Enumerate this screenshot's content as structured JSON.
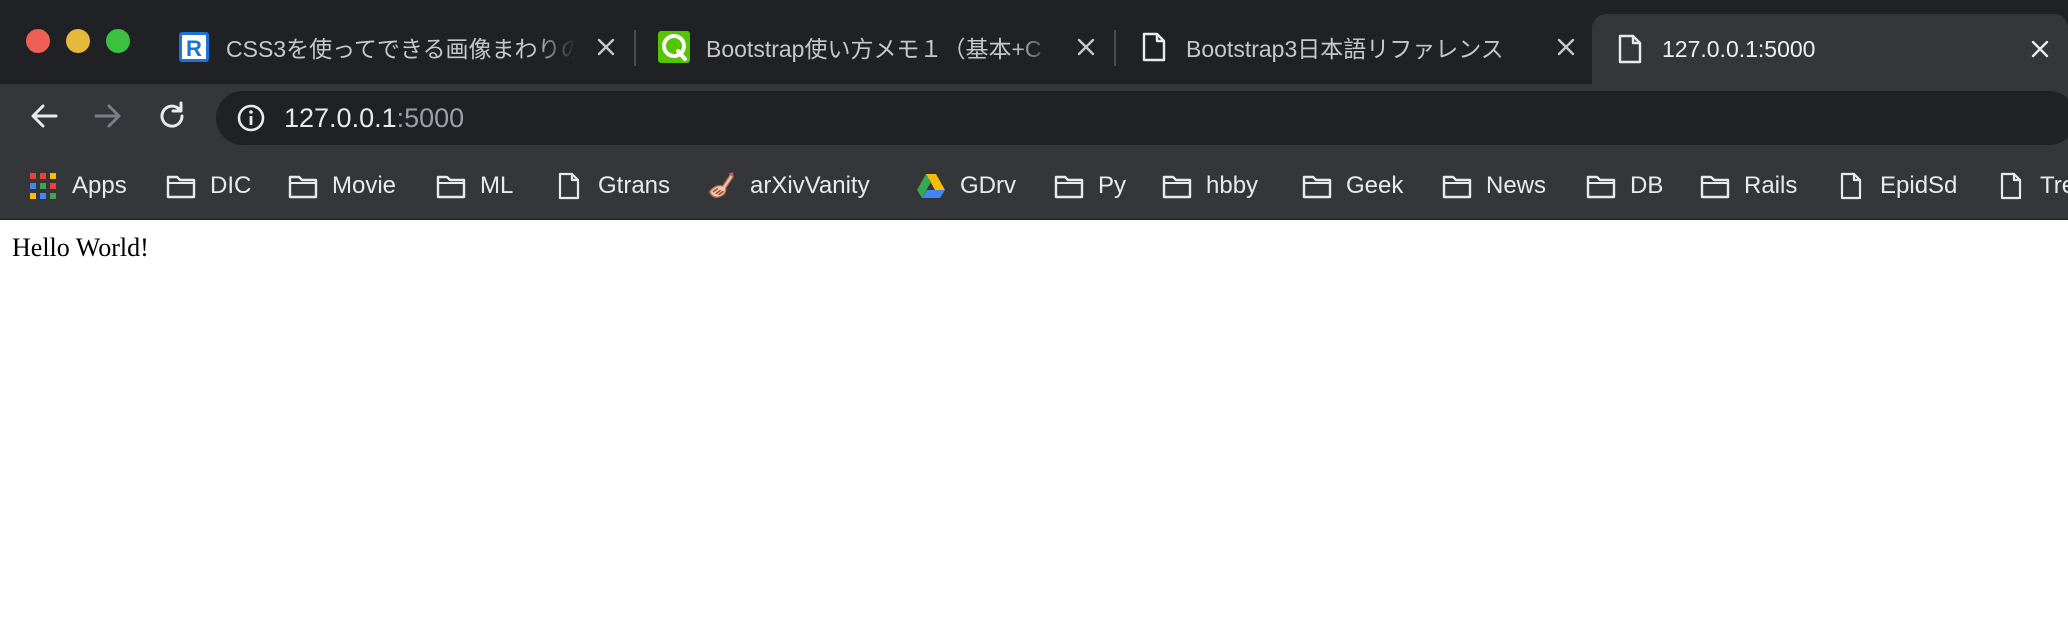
{
  "window": {
    "traffic_lights": {
      "close": "#ee5f57",
      "minimize": "#e6b83b",
      "maximize": "#3cc03f"
    }
  },
  "tabs": [
    {
      "title": "CSS3を使ってできる画像まわりの",
      "favicon": "r-logo-icon",
      "active": false
    },
    {
      "title": "Bootstrap使い方メモ１（基本+C",
      "favicon": "qiita-q-icon",
      "active": false
    },
    {
      "title": "Bootstrap3日本語リファレンス",
      "favicon": "page-icon",
      "active": false
    },
    {
      "title": "127.0.0.1:5000",
      "favicon": "page-icon",
      "active": true
    }
  ],
  "toolbar": {
    "back": "back-arrow-icon",
    "forward": "forward-arrow-icon",
    "reload": "reload-icon",
    "url_host": "127.0.0.1",
    "url_port": ":5000"
  },
  "bookmarks": [
    {
      "label": "Apps",
      "icon": "apps-grid-icon"
    },
    {
      "label": "DIC",
      "icon": "folder-icon"
    },
    {
      "label": "Movie",
      "icon": "folder-icon"
    },
    {
      "label": "ML",
      "icon": "folder-icon"
    },
    {
      "label": "Gtrans",
      "icon": "page-icon"
    },
    {
      "label": "arXivVanity",
      "icon": "arxiv-vanity-icon"
    },
    {
      "label": "GDrv",
      "icon": "google-drive-icon"
    },
    {
      "label": "Py",
      "icon": "folder-icon"
    },
    {
      "label": "hbby",
      "icon": "folder-icon"
    },
    {
      "label": "Geek",
      "icon": "folder-icon"
    },
    {
      "label": "News",
      "icon": "folder-icon"
    },
    {
      "label": "DB",
      "icon": "folder-icon"
    },
    {
      "label": "Rails",
      "icon": "folder-icon"
    },
    {
      "label": "EpidSd",
      "icon": "page-icon"
    },
    {
      "label": "Tre",
      "icon": "page-icon"
    }
  ],
  "page": {
    "body_text": "Hello World!"
  },
  "colors": {
    "tabstrip_bg": "#202124",
    "toolbar_bg": "#35363a",
    "omnibox_bg": "#202124",
    "url_text": "#e8eaed",
    "url_port_text": "#9aa0a6"
  }
}
